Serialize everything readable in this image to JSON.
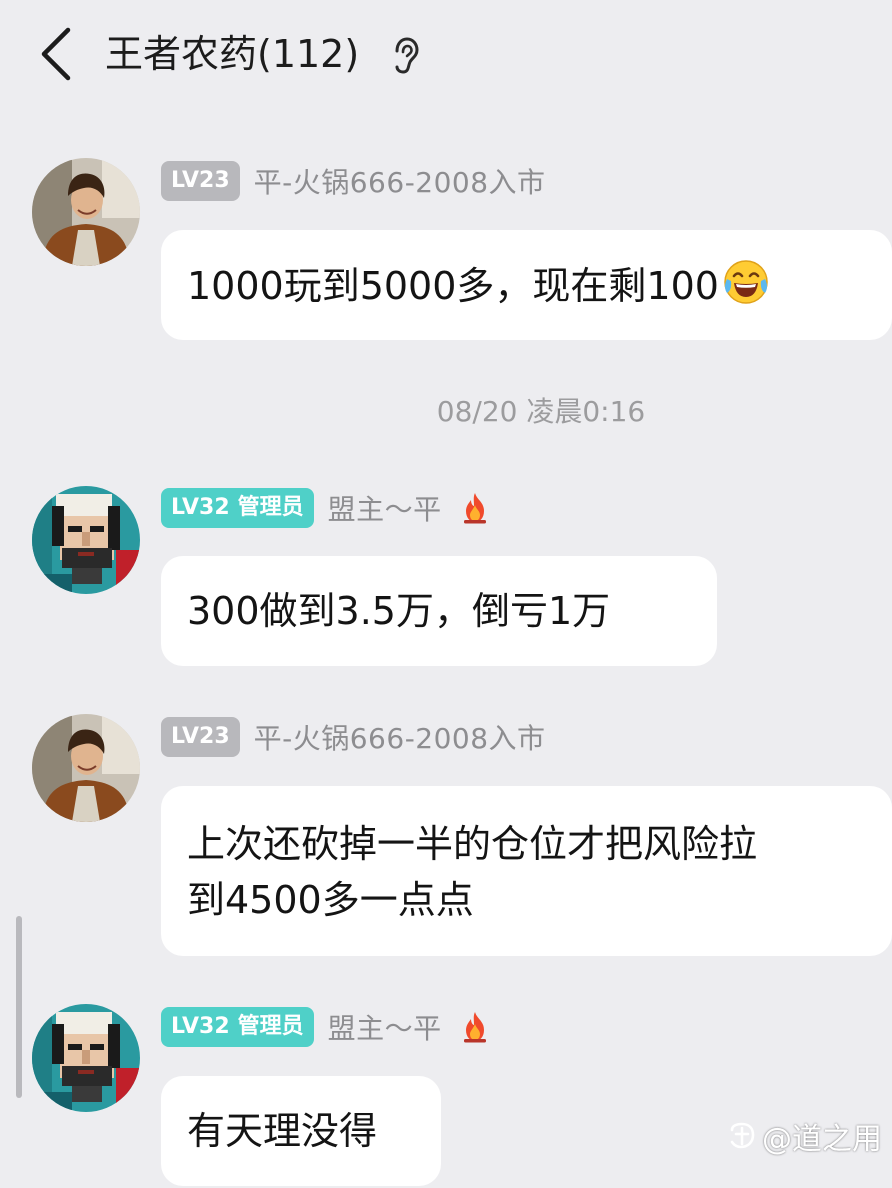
{
  "header": {
    "title": "王者农药(112)"
  },
  "timestamp": "08/20 凌晨0:16",
  "messages": [
    {
      "level": "LV23",
      "role": "",
      "nickname": "平-火锅666-2008入市",
      "avatar": "young-man-photo",
      "text": "1000玩到5000多，现在剩100"
    },
    {
      "level": "LV32",
      "role": "管理员",
      "nickname": "盟主～平",
      "avatar": "pixel-art-face",
      "text": "300做到3.5万，倒亏1万"
    },
    {
      "level": "LV23",
      "role": "",
      "nickname": "平-火锅666-2008入市",
      "avatar": "young-man-photo",
      "text_line1": "上次还砍掉一半的仓位才把风险拉",
      "text_line2": "到4500多一点点"
    },
    {
      "level": "LV32",
      "role": "管理员",
      "nickname": "盟主～平",
      "avatar": "pixel-art-face",
      "text": "有天理没得"
    }
  ],
  "watermark": "@道之用",
  "colors": {
    "background": "#ededf0",
    "bubble": "#ffffff",
    "badge_gray": "#b8b8bc",
    "badge_teal": "#4fd0c8",
    "nickname": "#8d8d90"
  },
  "icons": {
    "back": "chevron-left-icon",
    "ear": "ear-icon",
    "fire": "fire-icon",
    "emoji": "laughing-tears-emoji",
    "watermark_logo": "zhihu-logo-icon"
  }
}
